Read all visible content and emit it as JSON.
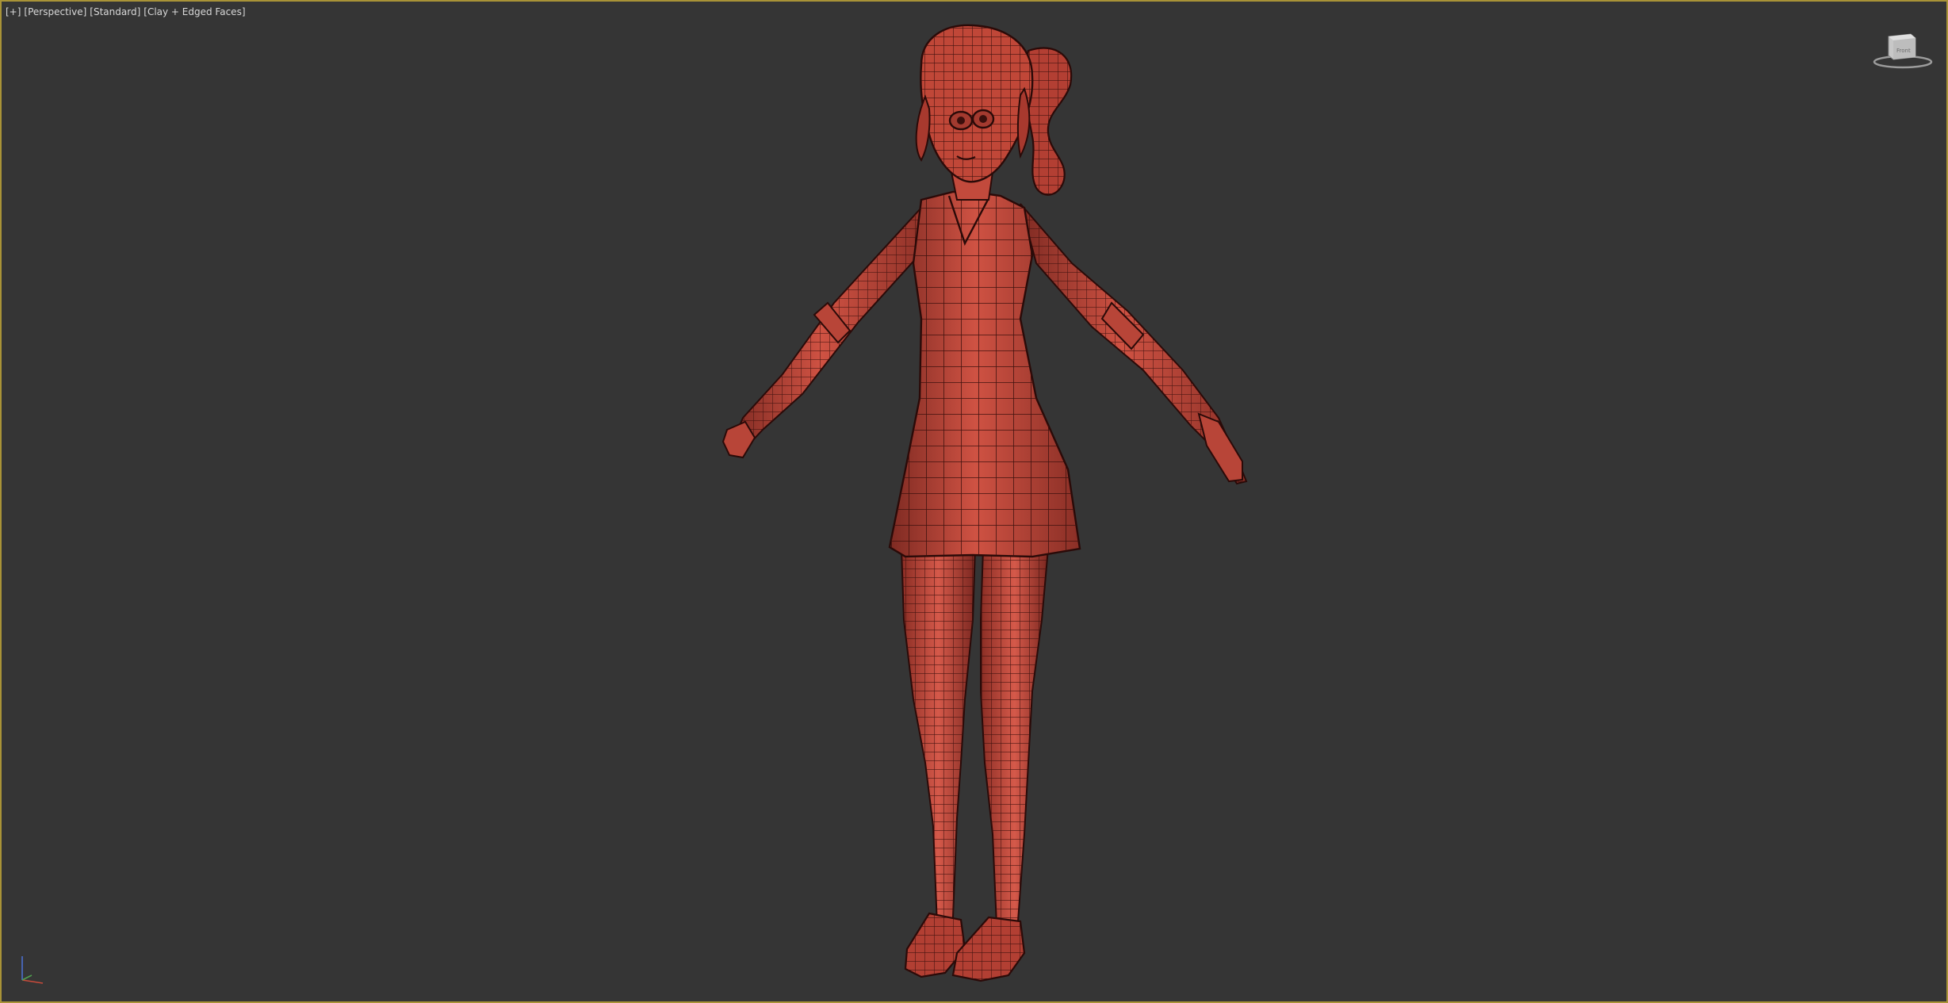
{
  "viewport": {
    "labels": [
      "[+]",
      "[Perspective]",
      "[Standard]",
      "[Clay + Edged Faces]"
    ],
    "active_border_color": "#a99337",
    "background_color": "#353535"
  },
  "viewcube": {
    "icon": "viewcube-icon",
    "face_label": "Front"
  },
  "axis_gizmo": {
    "icon": "axis-tripod-icon",
    "x_color": "#c84a3a",
    "y_color": "#4fa04f",
    "z_color": "#4a6fd0"
  },
  "model": {
    "name_icon": "character-mesh",
    "clay_color": "#c3473a",
    "wire_color": "#3a0f0c"
  }
}
